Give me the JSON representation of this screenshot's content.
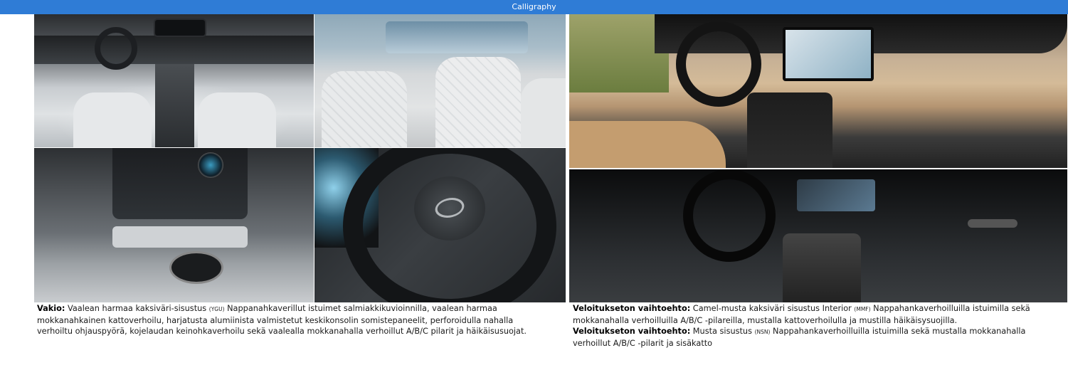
{
  "header": {
    "title": "Calligraphy"
  },
  "left_caption": {
    "label": "Vakio:",
    "text_before_code": " Vaalean harmaa kaksiväri-sisustus ",
    "code": "(YGU)",
    "text_after_code": " Nappanahkaverillut istuimet salmiakkikuvioinnilla, vaalean harmaa mokkanahkainen kattoverhoilu, harjatusta alumiinista valmistetut keskikonsolin somistepaneelit, perforoidulla nahalla verhoiltu ohjauspyörä, kojelaudan keinohkaverhoilu sekä vaalealla mokkanahalla verhoillut A/B/C pilarit ja häikäisusuojat."
  },
  "right_caption_1": {
    "label": "Veloitukseton vaihtoehto:",
    "text_before_code": " Camel-musta kaksiväri sisustus Interior ",
    "code": "(MMF)",
    "text_after_code": " Nappahankaverhoilluilla istuimilla sekä mokkanahalla verhoilluilla A/B/C -pilareilla, mustalla kattoverhoilulla ja mustilla häikäisysuojilla."
  },
  "right_caption_2": {
    "label": "Veloitukseton vaihtoehto:",
    "text_before_code": " Musta sisustus ",
    "code": "(NSN)",
    "text_after_code": " Nappahankaverhoilluilla istuimilla sekä mustalla mokkanahalla verhoillut A/B/C -pilarit ja sisäkatto"
  },
  "colors": {
    "header_bg": "#2f7cd6",
    "header_text": "#ffffff",
    "text": "#1a1a1a"
  }
}
